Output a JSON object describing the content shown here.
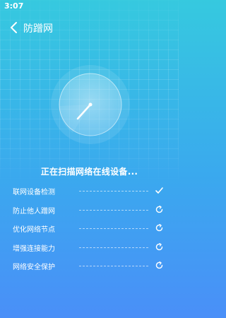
{
  "status_bar": {
    "time": "3:07"
  },
  "nav": {
    "title": "防蹭网"
  },
  "scan": {
    "status_text": "正在扫描网络在线设备..."
  },
  "checklist": [
    {
      "label": "联网设备检测",
      "state": "done",
      "icon": "checkmark-icon"
    },
    {
      "label": "防止他人蹭网",
      "state": "in-progress",
      "icon": "loading-icon"
    },
    {
      "label": "优化网络节点",
      "state": "pending",
      "icon": "refresh-icon"
    },
    {
      "label": "增强连接能力",
      "state": "pending",
      "icon": "refresh-icon"
    },
    {
      "label": "网络安全保护",
      "state": "pending",
      "icon": "refresh-icon"
    }
  ],
  "colors": {
    "gradient_top": "#36c9df",
    "gradient_bottom": "#4a8ff8",
    "text": "#ffffff"
  }
}
